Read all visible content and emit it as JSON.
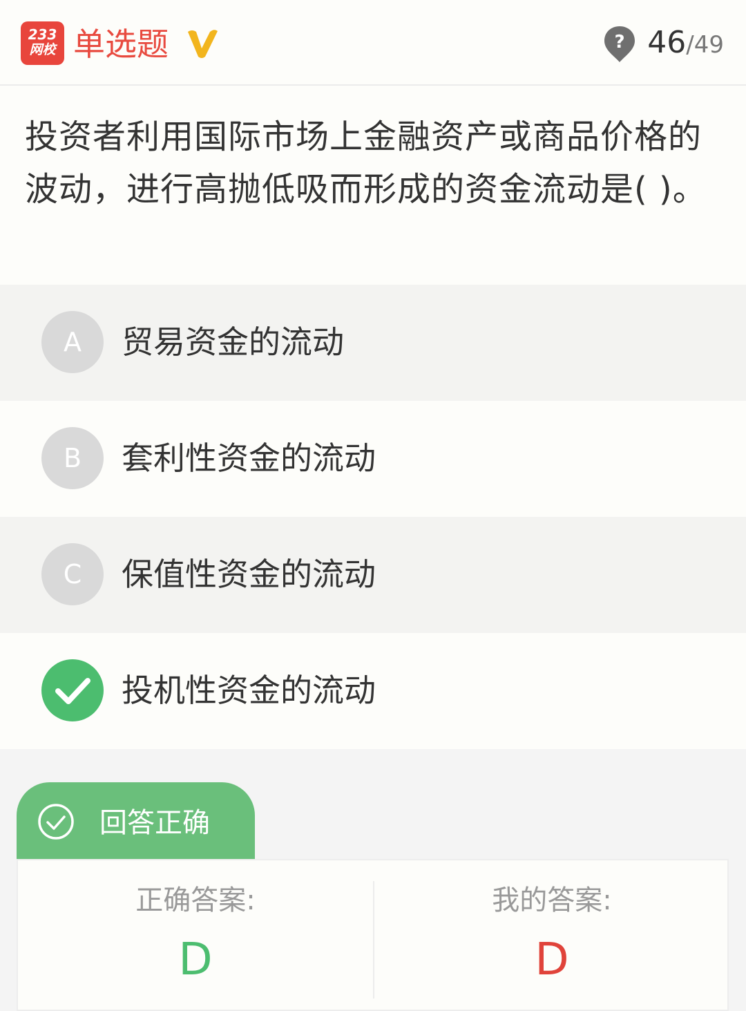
{
  "header": {
    "logo_top": "233",
    "logo_bottom": "网校",
    "question_type": "单选题",
    "current": "46",
    "total": "/49"
  },
  "question": {
    "text": "投资者利用国际市场上金融资产或商品价格的波动，进行高抛低吸而形成的资金流动是( )。"
  },
  "options": [
    {
      "letter": "A",
      "text": "贸易资金的流动",
      "state": "unselected"
    },
    {
      "letter": "B",
      "text": "套利性资金的流动",
      "state": "unselected"
    },
    {
      "letter": "C",
      "text": "保值性资金的流动",
      "state": "unselected"
    },
    {
      "letter": "D",
      "text": "投机性资金的流动",
      "state": "correct",
      "icon": "check-icon"
    }
  ],
  "result": {
    "label": "回答正确",
    "icon": "check-circle-icon",
    "correct_answer_label": "正确答案:",
    "correct_answer": "D",
    "my_answer_label": "我的答案:",
    "my_answer": "D"
  },
  "colors": {
    "brand_red": "#e84a3f",
    "vip_gold": "#f2b51d",
    "correct_green": "#4cbd6f",
    "result_green": "#6abf7b",
    "my_answer_red": "#e0433a",
    "option_grey": "#d9d9d9"
  },
  "icons": {
    "vip": "vip-v-icon",
    "hint": "question-hint-icon"
  }
}
